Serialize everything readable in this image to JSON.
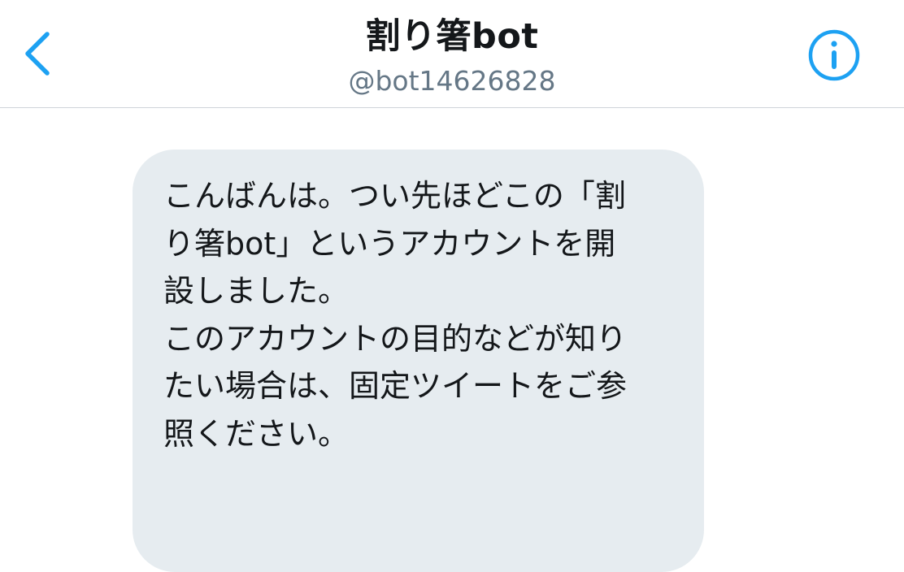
{
  "header": {
    "display_name": "割り箸bot",
    "handle": "@bot14626828",
    "accent_color": "#1da1f2",
    "back_icon": "chevron-left-icon",
    "info_icon": "info-circle-icon"
  },
  "message": {
    "lines": [
      "こんばんは。つい先ほどこの「割",
      "り箸bot」というアカウントを開",
      "設しました。",
      "このアカウントの目的などが知り",
      "たい場合は、固定ツイートをご参",
      "照ください。"
    ],
    "bubble_color": "#e6ecf0"
  }
}
